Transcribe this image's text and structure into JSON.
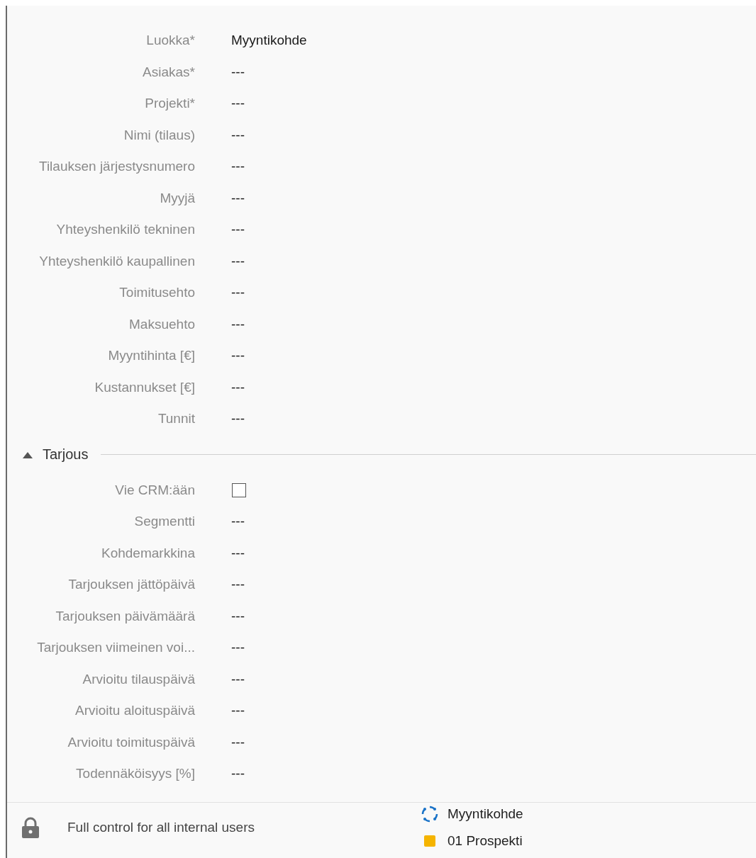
{
  "fields": [
    {
      "label": "Luokka*",
      "kind": "text",
      "value": "Myyntikohde"
    },
    {
      "label": "Asiakas*",
      "kind": "text",
      "value": "---"
    },
    {
      "label": "Projekti*",
      "kind": "text",
      "value": "---"
    },
    {
      "label": "Nimi (tilaus)",
      "kind": "text",
      "value": "---"
    },
    {
      "label": "Tilauksen järjestysnumero",
      "kind": "text",
      "value": "---"
    },
    {
      "label": "Myyjä",
      "kind": "text",
      "value": "---"
    },
    {
      "label": "Yhteyshenkilö tekninen",
      "kind": "text",
      "value": "---"
    },
    {
      "label": "Yhteyshenkilö kaupallinen",
      "kind": "text",
      "value": "---"
    },
    {
      "label": "Toimitusehto",
      "kind": "text",
      "value": "---"
    },
    {
      "label": "Maksuehto",
      "kind": "text",
      "value": "---"
    },
    {
      "label": "Myyntihinta [€]",
      "kind": "text",
      "value": "---"
    },
    {
      "label": "Kustannukset [€]",
      "kind": "text",
      "value": "---"
    },
    {
      "label": "Tunnit",
      "kind": "text",
      "value": "---"
    }
  ],
  "section": {
    "title": "Tarjous",
    "expanded": true,
    "fields": [
      {
        "label": "Vie CRM:ään",
        "kind": "checkbox",
        "checked": false
      },
      {
        "label": "Segmentti",
        "kind": "text",
        "value": "---"
      },
      {
        "label": "Kohdemarkkina",
        "kind": "text",
        "value": "---"
      },
      {
        "label": "Tarjouksen jättöpäivä",
        "kind": "text",
        "value": "---"
      },
      {
        "label": "Tarjouksen päivämäärä",
        "kind": "text",
        "value": "---"
      },
      {
        "label": "Tarjouksen viimeinen voi...",
        "kind": "text",
        "value": "---"
      },
      {
        "label": "Arvioitu tilauspäivä",
        "kind": "text",
        "value": "---"
      },
      {
        "label": "Arvioitu aloituspäivä",
        "kind": "text",
        "value": "---"
      },
      {
        "label": "Arvioitu toimituspäivä",
        "kind": "text",
        "value": "---"
      },
      {
        "label": "Todennäköisyys [%]",
        "kind": "text",
        "value": "---"
      }
    ]
  },
  "footer": {
    "permission": "Full control for all internal users",
    "status": [
      {
        "kind": "type",
        "label": "Myyntikohde"
      },
      {
        "kind": "phase",
        "label": "01 Prospekti",
        "color": "#f5b400"
      }
    ]
  }
}
